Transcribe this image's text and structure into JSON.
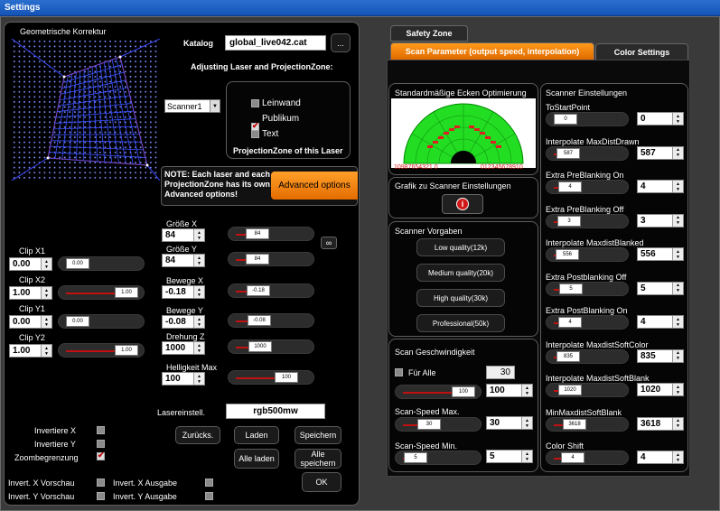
{
  "window": {
    "title": "Settings"
  },
  "left": {
    "geom_title": "Geometrische Korrektur",
    "clips": [
      {
        "label": "Clip X1",
        "value": "0.00",
        "slider": "0.00",
        "pos": 0.0
      },
      {
        "label": "Clip X2",
        "value": "1.00",
        "slider": "1.00",
        "pos": 1.0
      },
      {
        "label": "Clip Y1",
        "value": "0.00",
        "slider": "0.00",
        "pos": 0.0
      },
      {
        "label": "Clip Y2",
        "value": "1.00",
        "slider": "1.00",
        "pos": 1.0
      }
    ],
    "checks": {
      "invert_x": "Invertiere X",
      "invert_y": "Invertiere Y",
      "zoom": "Zoombegrenzung",
      "invert_x_preview": "Invert. X Vorschau",
      "invert_y_preview": "Invert. Y Vorschau",
      "invert_x_output": "Invert. X Ausgabe",
      "invert_y_output": "Invert. Y Ausgabe"
    }
  },
  "middle": {
    "katalog_label": "Katalog",
    "katalog_value": "global_live042.cat",
    "browse": "...",
    "adjust_title": "Adjusting Laser and ProjectionZone:",
    "scanner_select": "Scanner1",
    "zones": [
      {
        "label": "Leinwand",
        "checked": false
      },
      {
        "label": "Publikum",
        "checked": true
      },
      {
        "label": "Text",
        "checked": false
      }
    ],
    "zone_caption": "ProjectionZone of this Laser",
    "note": "NOTE: Each laser and each ProjectionZone has its own Advanced options!",
    "advanced_btn": "Advanced options",
    "params": [
      {
        "label": "Größe X",
        "value": "84",
        "slider": "84",
        "pos": 0.2
      },
      {
        "label": "Größe Y",
        "value": "84",
        "slider": "84",
        "pos": 0.2
      },
      {
        "label": "Bewege X",
        "value": "-0.18",
        "slider": "-0.18",
        "pos": 0.22
      },
      {
        "label": "Bewege Y",
        "value": "-0.08",
        "slider": "-0.08",
        "pos": 0.24
      },
      {
        "label": "Drehung Z",
        "value": "1000",
        "slider": "1000",
        "pos": 0.25
      },
      {
        "label": "Helligkeit Max",
        "value": "100",
        "slider": "100",
        "pos": 0.8
      }
    ],
    "laser_label": "Lasereinstell.",
    "laser_value": "rgb500mw",
    "buttons": {
      "back": "Zurücks.",
      "load": "Laden",
      "save": "Speichern",
      "load_all": "Alle laden",
      "save_all": "Alle speichern",
      "ok": "OK"
    }
  },
  "right": {
    "tabs": {
      "safety": "Safety Zone",
      "scan": "Scan Parameter (output speed, interpolation)",
      "color": "Color Settings"
    },
    "corner_title": "Standardmäßige Ecken Optimierung",
    "arc_labels_left": "10987654321 0",
    "arc_labels_right": "012345678910",
    "grafik_title": "Grafik zu Scanner Einstellungen",
    "vorgaben_title": "Scanner Vorgaben",
    "presets": [
      "Low quality(12k)",
      "Medium quality(20k)",
      "High quality(30k)",
      "Professional(50k)"
    ],
    "speed_title": "Scan Geschwindigkeit",
    "fuer_alle": "Für Alle",
    "fuer_alle_value": "30",
    "speed_main": {
      "slider": "100",
      "value": "100",
      "pos": 1.0
    },
    "speed_max": {
      "label": "Scan-Speed Max.",
      "slider": "30",
      "value": "30",
      "pos": 0.3
    },
    "speed_min": {
      "label": "Scan-Speed Min.",
      "slider": "5",
      "value": "5",
      "pos": 0.02
    },
    "scanner_title": "Scanner Einstellungen",
    "scanner_settings": [
      {
        "label": "ToStartPoint",
        "slider": "0",
        "value": "0",
        "pos": 0.0
      },
      {
        "label": "Interpolate MaxDistDrawn",
        "slider": "587",
        "value": "587",
        "pos": 0.05
      },
      {
        "label": "Extra PreBlanking On",
        "slider": "4",
        "value": "4",
        "pos": 0.1
      },
      {
        "label": "Extra PreBlanking Off",
        "slider": "3",
        "value": "3",
        "pos": 0.08
      },
      {
        "label": "Interpolate MaxdistBlanked",
        "slider": "556",
        "value": "556",
        "pos": 0.04
      },
      {
        "label": "Extra Postblanking Off",
        "slider": "5",
        "value": "5",
        "pos": 0.12
      },
      {
        "label": "Extra PostBlanking On",
        "slider": "4",
        "value": "4",
        "pos": 0.1
      },
      {
        "label": "Interpolate MaxdistSoftColor",
        "slider": "835",
        "value": "835",
        "pos": 0.06
      },
      {
        "label": "Interpolate MaxdistSoftBlank",
        "slider": "1020",
        "value": "1020",
        "pos": 0.1
      },
      {
        "label": "MinMaxdistSoftBlank",
        "slider": "3618",
        "value": "3618",
        "pos": 0.2
      },
      {
        "label": "Color Shift",
        "slider": "4",
        "value": "4",
        "pos": 0.15
      }
    ]
  }
}
